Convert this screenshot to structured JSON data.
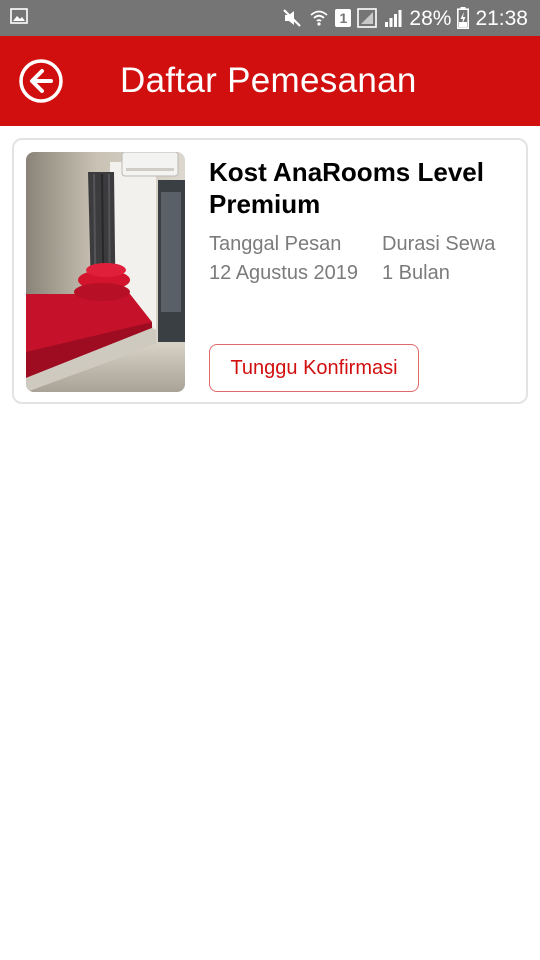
{
  "status_bar": {
    "battery_percent": "28%",
    "time": "21:38",
    "sim_slot": "1",
    "icons": [
      "gallery-icon",
      "mute-icon",
      "wifi-icon",
      "sim-icon",
      "signal-icon",
      "battery-charging-icon"
    ]
  },
  "app_bar": {
    "title": "Daftar Pemesanan",
    "back_icon": "back-arrow-circle-icon",
    "color": "#d20f0f"
  },
  "bookings": [
    {
      "name": "Kost AnaRooms Level Premium",
      "order_date_label": "Tanggal Pesan",
      "order_date": "12 Agustus 2019",
      "duration_label": "Durasi Sewa",
      "duration": "1 Bulan",
      "status": "Tunggu Konfirmasi",
      "image": "room-photo"
    }
  ]
}
